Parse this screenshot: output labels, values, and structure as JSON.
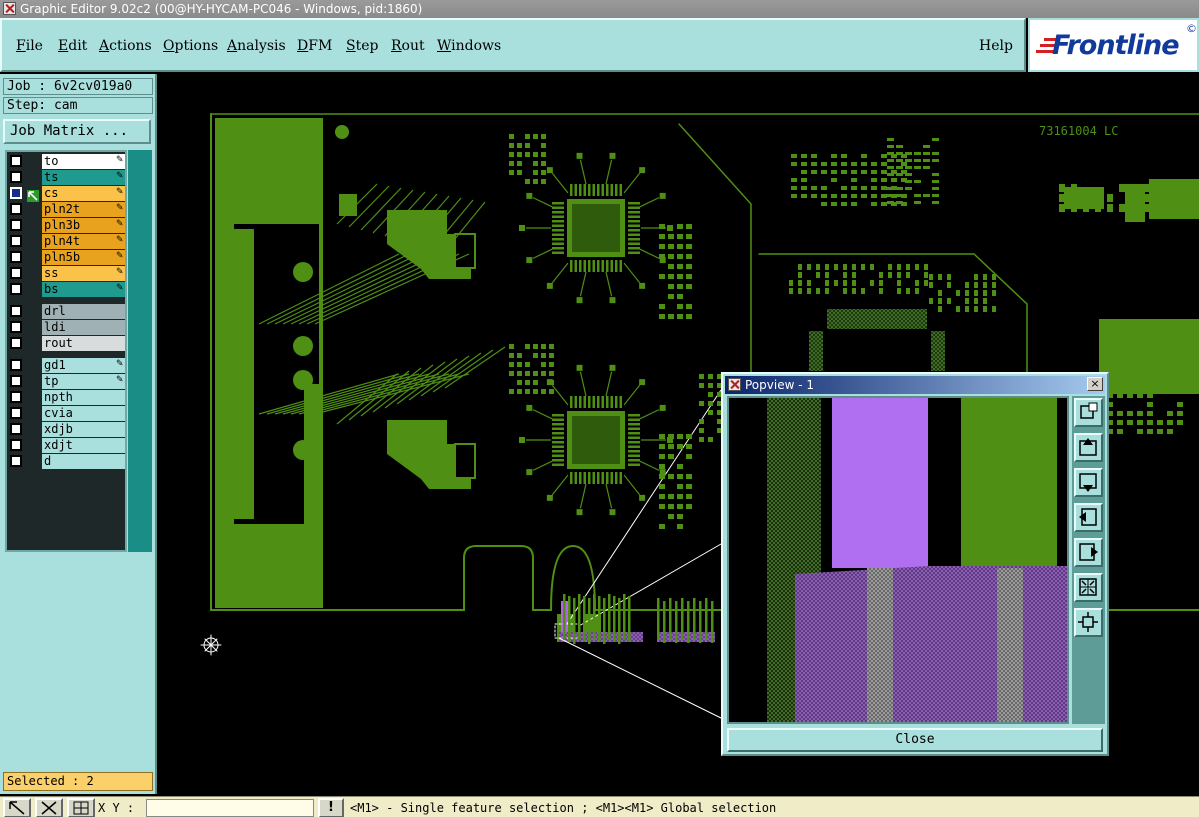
{
  "window": {
    "title": "Graphic Editor 9.02c2 (00@HY-HYCAM-PC046 - Windows, pid:1860)"
  },
  "menu": {
    "items": [
      {
        "label": "File",
        "key": "F",
        "rest": "ile"
      },
      {
        "label": "Edit",
        "key": "E",
        "rest": "dit"
      },
      {
        "label": "Actions",
        "key": "A",
        "rest": "ctions"
      },
      {
        "label": "Options",
        "key": "O",
        "rest": "ptions"
      },
      {
        "label": "Analysis",
        "key": "A",
        "rest": "nalysis"
      },
      {
        "label": "DFM",
        "key": "D",
        "rest": "FM"
      },
      {
        "label": "Step",
        "key": "S",
        "rest": "tep"
      },
      {
        "label": "Rout",
        "key": "R",
        "rest": "out"
      },
      {
        "label": "Windows",
        "key": "W",
        "rest": "indows"
      }
    ],
    "help": "Help"
  },
  "logo": {
    "text": "Frontline",
    "reg": "©"
  },
  "job": {
    "label": "Job : 6v2cv019a0"
  },
  "step": {
    "label": "Step: cam"
  },
  "job_matrix": "Job Matrix ...",
  "layers": [
    {
      "name": "to",
      "color": "#ffffff",
      "edit": true
    },
    {
      "name": "ts",
      "color": "#1f9a8e",
      "edit": true
    },
    {
      "name": "cs",
      "color": "#fbc24a",
      "edit": true,
      "selected": true
    },
    {
      "name": "pln2t",
      "color": "#e8a21e",
      "edit": true
    },
    {
      "name": "pln3b",
      "color": "#e8a21e",
      "edit": true
    },
    {
      "name": "pln4t",
      "color": "#e8a21e",
      "edit": true
    },
    {
      "name": "pln5b",
      "color": "#e8a21e",
      "edit": true
    },
    {
      "name": "ss",
      "color": "#fbc24a",
      "edit": true
    },
    {
      "name": "bs",
      "color": "#1f9a8e",
      "edit": true
    },
    {
      "name": "drl",
      "color": "#9fb1b4",
      "edit": false
    },
    {
      "name": "ldi",
      "color": "#9fb1b4",
      "edit": false
    },
    {
      "name": "rout",
      "color": "#d8dcdc",
      "edit": false
    },
    {
      "name": "gd1",
      "color": "#a9dfdc",
      "edit": true
    },
    {
      "name": "tp",
      "color": "#a9dfdc",
      "edit": true
    },
    {
      "name": "npth",
      "color": "#a9dfdc",
      "edit": false
    },
    {
      "name": "cvia",
      "color": "#a9dfdc",
      "edit": false
    },
    {
      "name": "xdjb",
      "color": "#a9dfdc",
      "edit": false
    },
    {
      "name": "xdjt",
      "color": "#a9dfdc",
      "edit": false
    },
    {
      "name": "d",
      "color": "#a9dfdc",
      "edit": false
    }
  ],
  "selected": "Selected : 2",
  "canvas": {
    "board_label": "73161004 LC",
    "trace_color": "#4f8f14"
  },
  "status": {
    "xy_label": "X Y :",
    "xy_value": "",
    "excl": "!",
    "message": "<M1> - Single feature selection ; <M1><M1> Global selection"
  },
  "popview": {
    "title": "Popview - 1",
    "close_label": "Close",
    "close_x": "×"
  }
}
